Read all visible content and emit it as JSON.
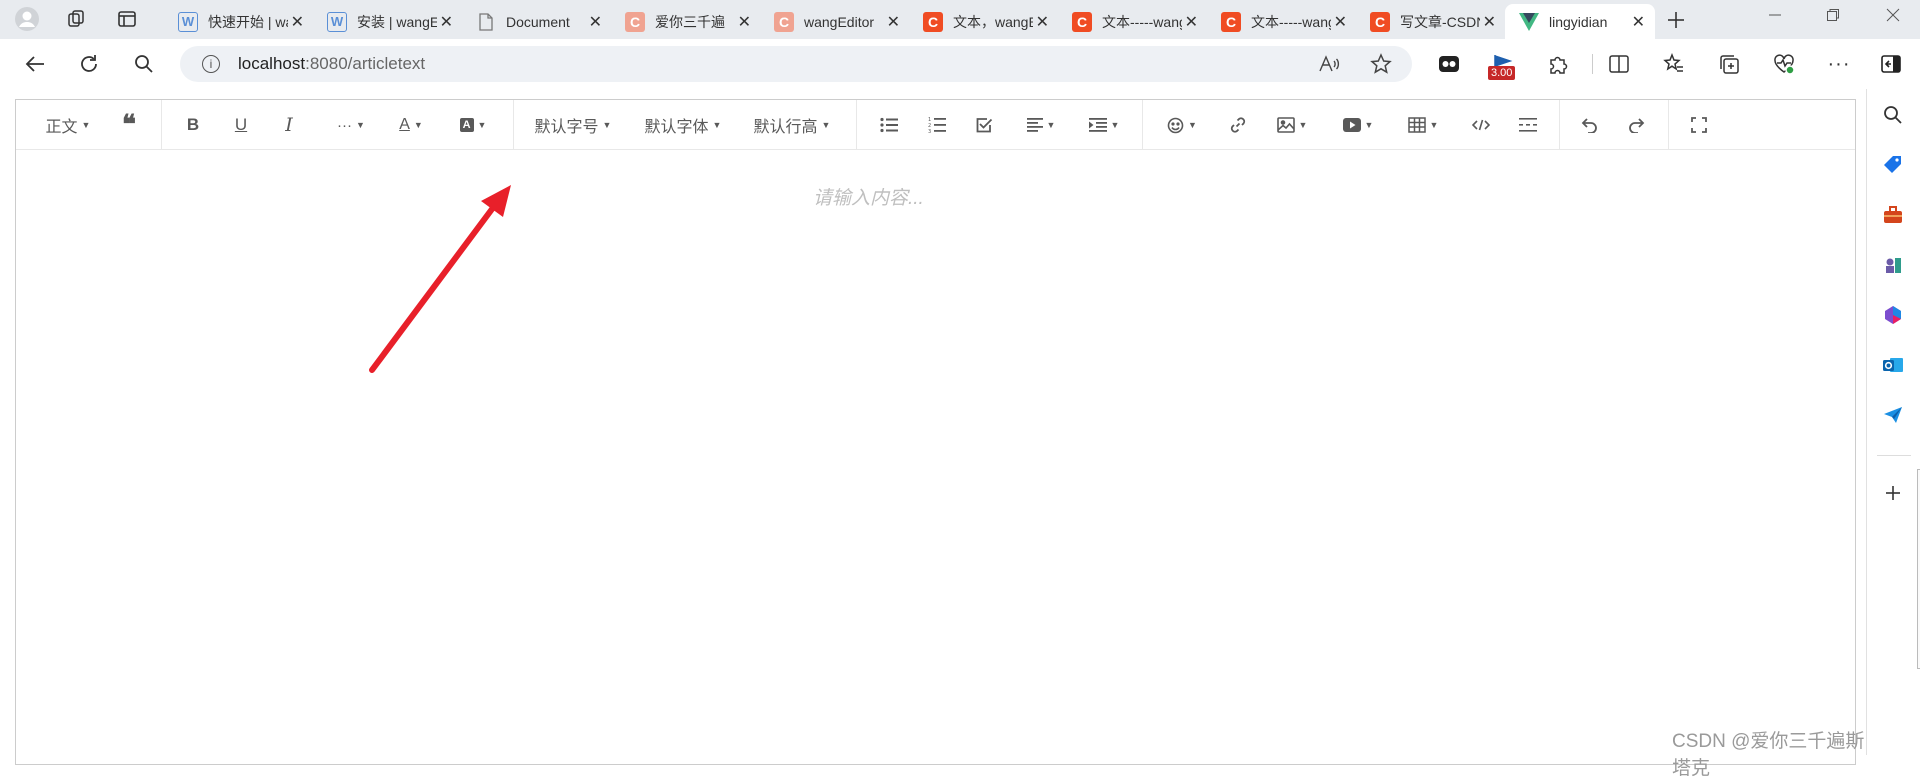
{
  "browser": {
    "tabs": [
      {
        "title": "快速开始 | wangEditor",
        "favicon": "W",
        "fav_color": "#5a8fd6",
        "active": false
      },
      {
        "title": "安装 | wangEditor",
        "favicon": "W",
        "fav_color": "#5a8fd6",
        "active": false
      },
      {
        "title": "Document",
        "favicon": "doc",
        "fav_color": "#777777",
        "active": false
      },
      {
        "title": "爱你三千遍",
        "favicon": "C",
        "fav_color": "#f0a391",
        "active": false
      },
      {
        "title": "wangEditor",
        "favicon": "C",
        "fav_color": "#f0a391",
        "active": false
      },
      {
        "title": "文本，wangEditor",
        "favicon": "C",
        "fav_color": "#f04c23",
        "active": false
      },
      {
        "title": "文本-----wangEditor",
        "favicon": "C",
        "fav_color": "#f04c23",
        "active": false
      },
      {
        "title": "文本-----wangEditor",
        "favicon": "C",
        "fav_color": "#f04c23",
        "active": false
      },
      {
        "title": "写文章-CSDN",
        "favicon": "C",
        "fav_color": "#f04c23",
        "active": false
      },
      {
        "title": "lingyidian",
        "favicon": "V",
        "fav_color": "#42b883",
        "active": true
      }
    ],
    "url_host": "localhost",
    "url_path": ":8080/articletext",
    "extension_badge": "3.00"
  },
  "editor": {
    "toolbar": {
      "paragraph": "正文",
      "font_size": "默认字号",
      "font_family": "默认字体",
      "line_height": "默认行高",
      "more": "···",
      "font_color": "A",
      "bg_color": "A"
    },
    "placeholder": "请输入内容..."
  },
  "watermark": "CSDN @爱你三千遍斯塔克",
  "annotation_color": "#e8202a"
}
